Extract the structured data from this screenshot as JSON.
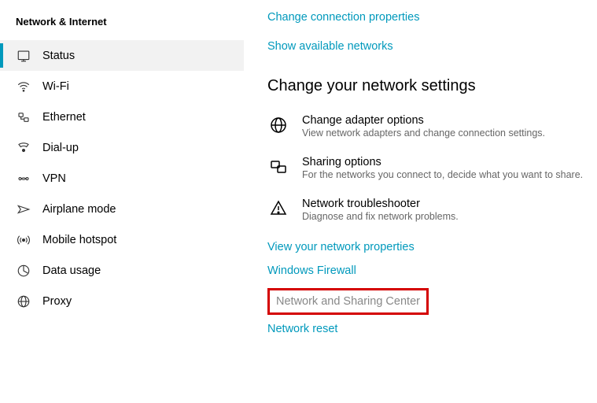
{
  "sidebar": {
    "title": "Network & Internet",
    "items": [
      {
        "label": "Status",
        "icon": "status-icon",
        "selected": true
      },
      {
        "label": "Wi-Fi",
        "icon": "wifi-icon",
        "selected": false
      },
      {
        "label": "Ethernet",
        "icon": "ethernet-icon",
        "selected": false
      },
      {
        "label": "Dial-up",
        "icon": "dialup-icon",
        "selected": false
      },
      {
        "label": "VPN",
        "icon": "vpn-icon",
        "selected": false
      },
      {
        "label": "Airplane mode",
        "icon": "airplane-icon",
        "selected": false
      },
      {
        "label": "Mobile hotspot",
        "icon": "hotspot-icon",
        "selected": false
      },
      {
        "label": "Data usage",
        "icon": "datausage-icon",
        "selected": false
      },
      {
        "label": "Proxy",
        "icon": "proxy-icon",
        "selected": false
      }
    ]
  },
  "main": {
    "top_links": [
      "Change connection properties",
      "Show available networks"
    ],
    "heading": "Change your network settings",
    "options": [
      {
        "title": "Change adapter options",
        "desc": "View network adapters and change connection settings.",
        "icon": "adapter-icon"
      },
      {
        "title": "Sharing options",
        "desc": "For the networks you connect to, decide what you want to share.",
        "icon": "sharing-icon"
      },
      {
        "title": "Network troubleshooter",
        "desc": "Diagnose and fix network problems.",
        "icon": "troubleshoot-icon"
      }
    ],
    "bottom_links": [
      "View your network properties",
      "Windows Firewall"
    ],
    "highlighted": "Network and Sharing Center",
    "final_link": "Network reset"
  }
}
